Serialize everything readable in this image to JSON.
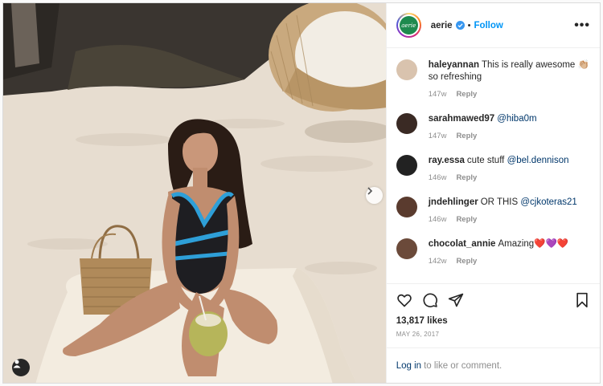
{
  "header": {
    "avatar_text": "aerie",
    "username": "aerie",
    "separator": "•",
    "follow_label": "Follow",
    "more_label": "•••"
  },
  "comments": [
    {
      "user": "haleyannan",
      "text": "This is really awesome 👏🏼 so refreshing",
      "mention": "",
      "time": "147w",
      "reply": "Reply",
      "avatar_color": "#d9c3ae"
    },
    {
      "user": "sarahmawed97",
      "text": "",
      "mention": "@hiba0m",
      "time": "147w",
      "reply": "Reply",
      "avatar_color": "#3a2a24"
    },
    {
      "user": "ray.essa",
      "text": "cute stuff",
      "mention": "@bel.dennison",
      "time": "146w",
      "reply": "Reply",
      "avatar_color": "#222222"
    },
    {
      "user": "jndehlinger",
      "text": "OR THIS",
      "mention": "@cjkoteras21",
      "time": "146w",
      "reply": "Reply",
      "avatar_color": "#5a3b2e"
    },
    {
      "user": "chocolat_annie",
      "text": "Amazing❤️💜❤️",
      "mention": "",
      "time": "142w",
      "reply": "Reply",
      "avatar_color": "#6b4a3a"
    }
  ],
  "likes": "13,817 likes",
  "date": "MAY 26, 2017",
  "login": {
    "link": "Log in",
    "text": "to like or comment."
  },
  "colors": {
    "accent": "#0095f6",
    "brand_green": "#1d8a4e",
    "heart": "#ed4956"
  },
  "icons": [
    "next-arrow-icon",
    "user-tag-icon",
    "verified-badge-icon",
    "heart-icon",
    "comment-icon",
    "share-icon",
    "bookmark-icon"
  ]
}
